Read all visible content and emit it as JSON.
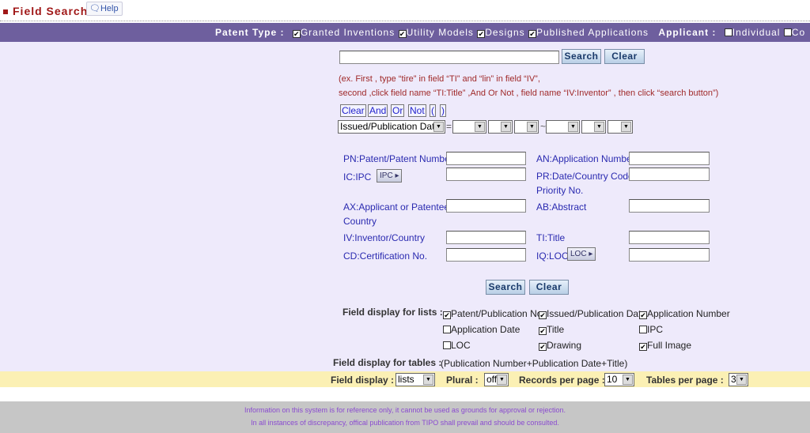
{
  "header": {
    "title": "Field Search",
    "help": "Help"
  },
  "filter_bar": {
    "patent_type_label": "Patent Type :",
    "patent_types": [
      {
        "label": "Granted Inventions",
        "checked": true
      },
      {
        "label": "Utility Models",
        "checked": true
      },
      {
        "label": "Designs",
        "checked": true
      },
      {
        "label": "Published Applications",
        "checked": true
      }
    ],
    "applicant_label": "Applicant :",
    "applicants": [
      {
        "label": "Individual",
        "checked": false
      },
      {
        "label": "Co",
        "checked": false
      }
    ]
  },
  "query": {
    "value": "",
    "search": "Search",
    "clear": "Clear",
    "hint1": "(ex. First , type “tire” in field “TI” and “lin” in field “IV”,",
    "hint2": "second ,click field name “TI:Title” ,And Or Not , field name “IV:Inventor” , then click “search button”)",
    "ops": [
      "Clear",
      "And",
      "Or",
      "Not",
      "(",
      ")"
    ],
    "date_field": "Issued/Publication Date",
    "eq": "=",
    "tilde": "~"
  },
  "fields": {
    "pn": "PN:Patent/Patent Number",
    "an": "AN:Application Number",
    "ic": "IC:IPC",
    "ipc_btn": "IPC ▸",
    "pr1": "PR:Date/Country Code/",
    "pr2": "Priority No.",
    "ax1": "AX:Applicant or Patentee/",
    "ax2": "Country",
    "ab": "AB:Abstract",
    "iv": "IV:Inventor/Country",
    "ti": "TI:Title",
    "cd": "CD:Certification No.",
    "iq": "IQ:LOC",
    "loc_btn": "LOC ▸",
    "search": "Search",
    "clear": "Clear"
  },
  "display": {
    "lists_label": "Field display for lists :",
    "list_items": [
      {
        "label": "Patent/Publication No.",
        "checked": true
      },
      {
        "label": "Issued/Publication Date",
        "checked": true
      },
      {
        "label": "Application Number",
        "checked": true
      },
      {
        "label": "Application Date",
        "checked": false
      },
      {
        "label": "Title",
        "checked": true
      },
      {
        "label": "IPC",
        "checked": false
      },
      {
        "label": "LOC",
        "checked": false
      },
      {
        "label": "Drawing",
        "checked": true
      },
      {
        "label": "Full Image",
        "checked": true
      }
    ],
    "tables_label": "Field display for tables :",
    "tables_value": "(Publication Number+Publication Date+Title)"
  },
  "options": {
    "field_display_label": "Field display :",
    "field_display": "lists",
    "plural_label": "Plural :",
    "plural": "off",
    "records_label": "Records per page :",
    "records": "10",
    "tables_label": "Tables per page  :",
    "tables": "3"
  },
  "footer": {
    "line1": "Information on this system is for reference only, it cannot be used as grounds for approval or rejection.",
    "line2": "In all instances of discrepancy, offical publication from TIPO shall prevail and should be consulted."
  }
}
